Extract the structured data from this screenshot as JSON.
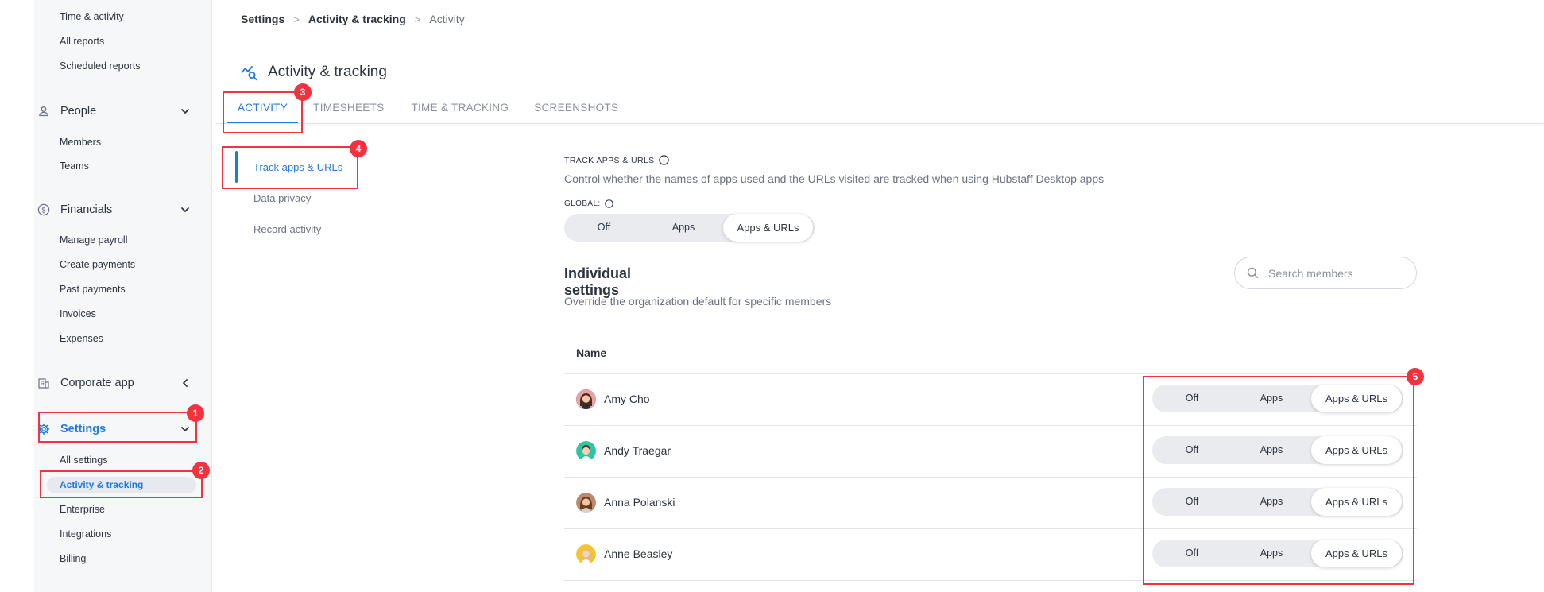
{
  "sidebar": {
    "reports_items": [
      "Time & activity",
      "All reports",
      "Scheduled reports"
    ],
    "people": {
      "label": "People",
      "items": [
        "Members",
        "Teams"
      ]
    },
    "financials": {
      "label": "Financials",
      "items": [
        "Manage payroll",
        "Create payments",
        "Past payments",
        "Invoices",
        "Expenses"
      ]
    },
    "corporate": {
      "label": "Corporate app"
    },
    "settings": {
      "label": "Settings",
      "items": [
        "All settings",
        "Activity & tracking",
        "Enterprise",
        "Integrations",
        "Billing"
      ],
      "active_item": "Activity & tracking"
    }
  },
  "breadcrumb": [
    "Settings",
    "Activity & tracking",
    "Activity"
  ],
  "page_title": "Activity & tracking",
  "tabs": [
    {
      "label": "ACTIVITY",
      "active": true
    },
    {
      "label": "TIMESHEETS",
      "active": false
    },
    {
      "label": "TIME & TRACKING",
      "active": false
    },
    {
      "label": "SCREENSHOTS",
      "active": false
    }
  ],
  "subnav": [
    {
      "label": "Track apps & URLs",
      "active": true
    },
    {
      "label": "Data privacy",
      "active": false
    },
    {
      "label": "Record activity",
      "active": false
    }
  ],
  "track_section": {
    "label": "TRACK APPS & URLS",
    "description": "Control whether the names of apps used and the URLs visited are tracked when using Hubstaff Desktop apps",
    "global_label": "GLOBAL:",
    "options": [
      "Off",
      "Apps",
      "Apps & URLs"
    ],
    "selected": "Apps & URLs"
  },
  "individual": {
    "title": "Individual settings",
    "description": "Override the organization default for specific members",
    "search_placeholder": "Search members",
    "column_name": "Name",
    "members": [
      {
        "name": "Amy Cho",
        "selected": "Apps & URLs"
      },
      {
        "name": "Andy Traegar",
        "selected": "Apps & URLs"
      },
      {
        "name": "Anna Polanski",
        "selected": "Apps & URLs"
      },
      {
        "name": "Anne Beasley",
        "selected": "Apps & URLs"
      }
    ]
  },
  "callouts": [
    "1",
    "2",
    "3",
    "4",
    "5"
  ],
  "colors": {
    "accent": "#1f7ae0",
    "callout": "#f2323f",
    "sidebar_bg": "#f6f7f9"
  }
}
